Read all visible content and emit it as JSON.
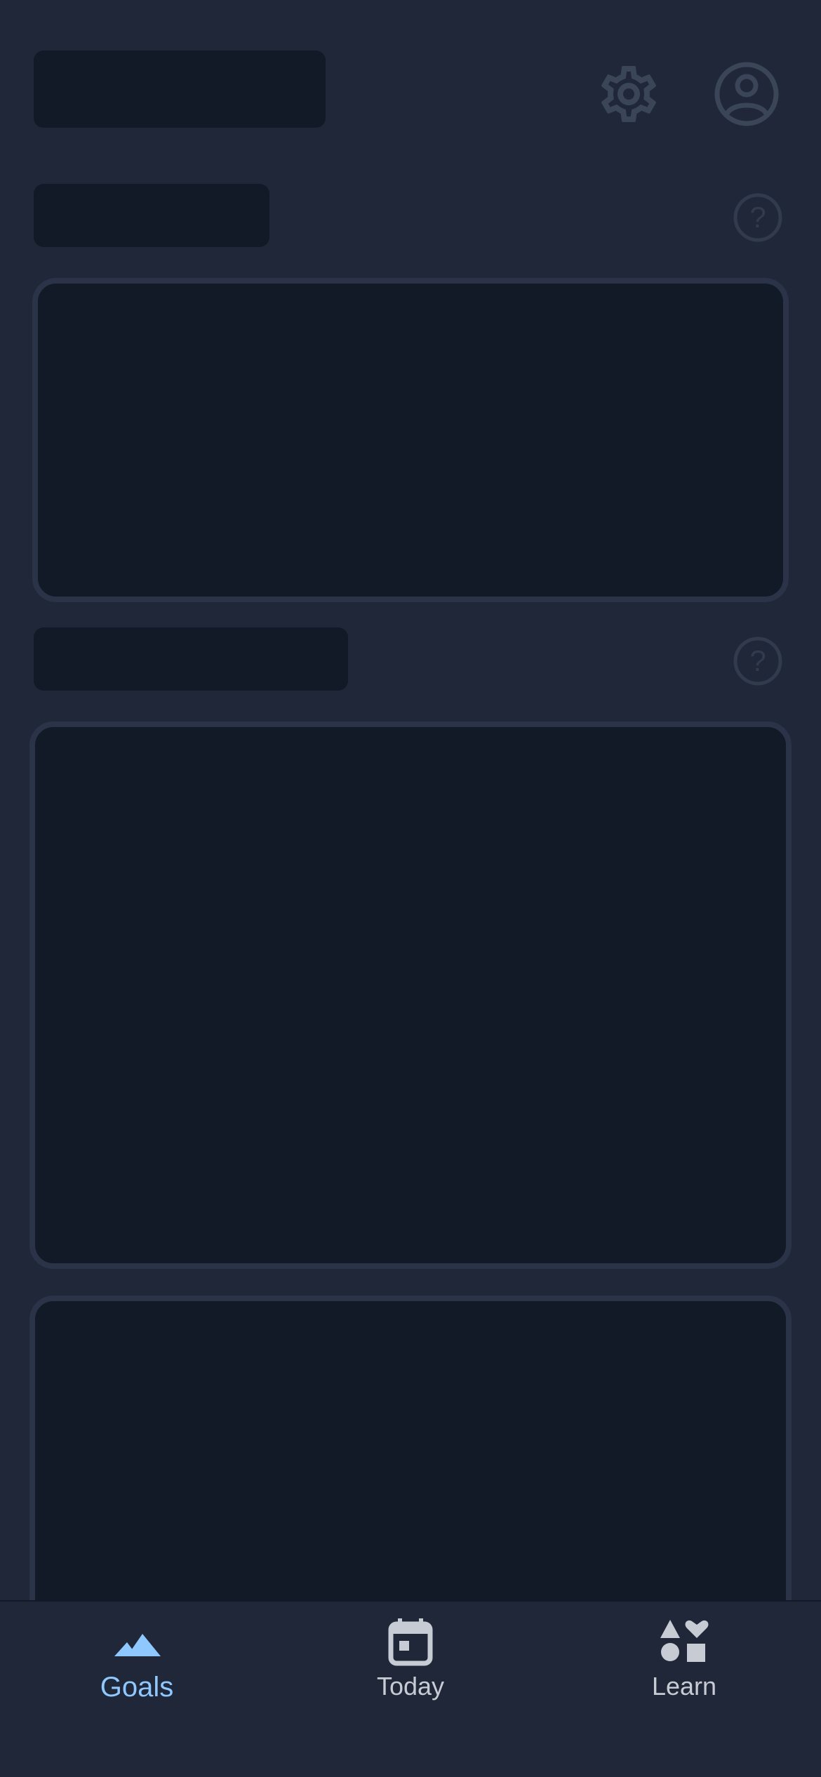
{
  "colors": {
    "background": "#1f2738",
    "skeleton": "#121927",
    "card_border": "#2a3347",
    "icon_muted": "#3b4558",
    "nav_inactive": "#c7cbd4",
    "nav_active": "#8fc7ff"
  },
  "header": {
    "settings_icon": "gear-icon",
    "profile_icon": "account-circle-icon"
  },
  "sections": [
    {
      "help_icon": "help-circle-icon"
    },
    {
      "help_icon": "help-circle-icon"
    }
  ],
  "bottom_nav": {
    "items": [
      {
        "label": "Goals",
        "icon": "mountains-icon",
        "active": true
      },
      {
        "label": "Today",
        "icon": "calendar-icon",
        "active": false
      },
      {
        "label": "Learn",
        "icon": "shapes-icon",
        "active": false
      }
    ]
  }
}
